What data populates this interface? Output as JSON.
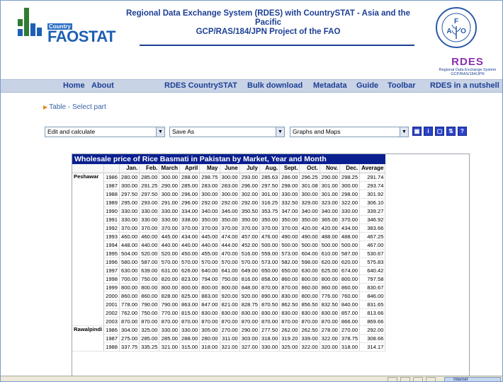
{
  "header": {
    "logo_country": "Country",
    "logo_fao": "FAO",
    "logo_stat": "STAT",
    "title_line1": "Regional Data Exchange System (RDES) with CountrySTAT - Asia and the",
    "title_line2": "Pacific",
    "title_line3": "GCP/RAS/184/JPN Project of the FAO",
    "rdes_badge": "RDES",
    "rdes_badge_sub1": "Regional Data Exchange System",
    "rdes_badge_sub2": "GCP/RAS/184/JPN"
  },
  "nav": {
    "home": "Home",
    "about": "About",
    "rdes_countrystat": "RDES CountrySTAT",
    "bulk_download": "Bulk download",
    "metadata": "Metadata",
    "guide": "Guide",
    "toolbar": "Toolbar",
    "rdes_nutshell": "RDES in a nutshell"
  },
  "breadcrumb": {
    "text": "Table - Select part"
  },
  "toolbar": {
    "edit_select": "Edit and calculate",
    "save_select": "Save As",
    "graphs_select": "Graphs and Maps",
    "icon_names": [
      "table-icon",
      "info-icon",
      "print-icon",
      "pivot-icon",
      "help-icon"
    ],
    "button_color": "#2a43c8"
  },
  "table": {
    "caption": "Wholesale price of Rice Basmati in Pakistan by Market, Year and Month",
    "columns": [
      "Jan.",
      "Feb.",
      "March",
      "April",
      "May",
      "June",
      "July",
      "Aug.",
      "Sept.",
      "Oct.",
      "Nov.",
      "Dec.",
      "Average"
    ],
    "markets": [
      {
        "name": "Peshawar",
        "rows": [
          {
            "year": "1986",
            "values": [
              "280.00",
              "285.00",
              "300.00",
              "288.00",
              "298.75",
              "300.00",
              "293.00",
              "285.63",
              "286.00",
              "296.25",
              "290.00",
              "298.25",
              "291.74"
            ]
          },
          {
            "year": "1987",
            "values": [
              "300.00",
              "291.25",
              "290.00",
              "285.00",
              "283.00",
              "283.00",
              "296.00",
              "297.50",
              "298.00",
              "301.08",
              "301.00",
              "300.00",
              "293.74"
            ]
          },
          {
            "year": "1988",
            "values": [
              "297.50",
              "297.50",
              "300.00",
              "296.00",
              "300.00",
              "300.00",
              "302.00",
              "301.00",
              "330.00",
              "300.00",
              "301.00",
              "298.00",
              "301.92"
            ]
          },
          {
            "year": "1989",
            "values": [
              "295.00",
              "293.00",
              "291.00",
              "296.00",
              "292.00",
              "292.00",
              "292.00",
              "316.25",
              "332.50",
              "329.00",
              "323.00",
              "322.00",
              "306.10"
            ]
          },
          {
            "year": "1990",
            "values": [
              "330.00",
              "330.00",
              "330.00",
              "334.00",
              "340.00",
              "346.00",
              "350.50",
              "353.75",
              "347.00",
              "340.00",
              "340.00",
              "330.00",
              "339.27"
            ]
          },
          {
            "year": "1991",
            "values": [
              "330.00",
              "330.00",
              "330.00",
              "338.00",
              "350.00",
              "350.00",
              "350.00",
              "350.00",
              "350.00",
              "350.00",
              "365.00",
              "370.00",
              "346.92"
            ]
          },
          {
            "year": "1992",
            "values": [
              "370.00",
              "370.00",
              "370.00",
              "370.00",
              "370.00",
              "370.00",
              "370.00",
              "370.00",
              "370.00",
              "420.00",
              "420.00",
              "434.00",
              "383.66"
            ]
          },
          {
            "year": "1993",
            "values": [
              "460.00",
              "460.00",
              "445.00",
              "434.00",
              "445.00",
              "474.00",
              "457.00",
              "476.00",
              "490.00",
              "490.00",
              "488.00",
              "488.00",
              "467.25"
            ]
          },
          {
            "year": "1994",
            "values": [
              "448.00",
              "440.00",
              "440.00",
              "440.00",
              "440.00",
              "444.00",
              "452.00",
              "500.00",
              "500.00",
              "500.00",
              "500.00",
              "500.00",
              "467.00"
            ]
          },
          {
            "year": "1995",
            "values": [
              "504.00",
              "520.00",
              "520.00",
              "450.00",
              "455.00",
              "470.00",
              "516.00",
              "559.00",
              "573.00",
              "604.00",
              "610.00",
              "587.00",
              "530.67"
            ]
          },
          {
            "year": "1996",
            "values": [
              "580.00",
              "587.00",
              "570.00",
              "570.00",
              "570.00",
              "570.00",
              "570.00",
              "573.00",
              "582.00",
              "598.00",
              "620.00",
              "620.00",
              "575.83"
            ]
          },
          {
            "year": "1997",
            "values": [
              "630.00",
              "639.00",
              "631.00",
              "626.00",
              "640.00",
              "641.00",
              "649.00",
              "650.00",
              "650.00",
              "630.00",
              "625.00",
              "674.00",
              "640.42"
            ]
          },
          {
            "year": "1998",
            "values": [
              "700.00",
              "750.00",
              "820.00",
              "823.00",
              "794.00",
              "750.00",
              "816.00",
              "858.00",
              "860.00",
              "800.00",
              "800.00",
              "800.00",
              "797.58"
            ]
          },
          {
            "year": "1999",
            "values": [
              "800.00",
              "800.00",
              "800.00",
              "800.00",
              "800.00",
              "800.00",
              "848.00",
              "870.00",
              "870.00",
              "860.00",
              "860.00",
              "860.00",
              "830.67"
            ]
          },
          {
            "year": "2000",
            "values": [
              "860.00",
              "860.00",
              "828.00",
              "825.00",
              "883.00",
              "920.00",
              "920.00",
              "890.00",
              "830.00",
              "800.00",
              "776.00",
              "760.00",
              "846.00"
            ]
          },
          {
            "year": "2001",
            "values": [
              "778.00",
              "790.00",
              "790.00",
              "863.00",
              "847.00",
              "821.00",
              "828.75",
              "870.50",
              "862.50",
              "856.50",
              "832.50",
              "840.00",
              "831.65"
            ]
          },
          {
            "year": "2002",
            "values": [
              "762.00",
              "750.00",
              "770.00",
              "815.00",
              "830.00",
              "830.00",
              "830.00",
              "830.00",
              "830.00",
              "830.00",
              "830.00",
              "857.00",
              "813.66"
            ]
          },
          {
            "year": "2003",
            "values": [
              "870.00",
              "870.00",
              "870.00",
              "870.00",
              "870.00",
              "870.00",
              "870.00",
              "870.00",
              "870.00",
              "870.00",
              "870.00",
              "866.00",
              "869.66"
            ]
          }
        ]
      },
      {
        "name": "Rawalpindi",
        "rows": [
          {
            "year": "1986",
            "values": [
              "304.00",
              "325.00",
              "330.00",
              "330.00",
              "305.00",
              "270.00",
              "290.00",
              "277.50",
              "262.00",
              "262.50",
              "278.00",
              "270.00",
              "292.00"
            ]
          },
          {
            "year": "1987",
            "values": [
              "275.00",
              "285.00",
              "285.00",
              "288.00",
              "280.00",
              "311.00",
              "303.00",
              "318.00",
              "319.20",
              "339.00",
              "322.00",
              "378.75",
              "308.66"
            ]
          },
          {
            "year": "1988",
            "values": [
              "337.75",
              "335.25",
              "321.00",
              "315.00",
              "318.00",
              "321.00",
              "327.00",
              "330.00",
              "325.00",
              "322.00",
              "320.00",
              "318.00",
              "314.17"
            ]
          }
        ]
      }
    ]
  },
  "statusbar": {
    "zone": "Internet"
  }
}
